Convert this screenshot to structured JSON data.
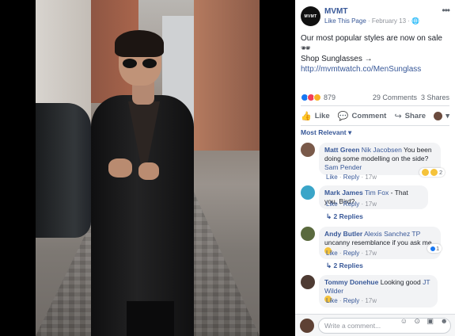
{
  "page": {
    "avatar_text": "MVMT",
    "name": "MVMT",
    "like_page": "Like This Page",
    "separator": " · ",
    "date": "February 13",
    "privacy_icon": "globe-icon",
    "more_icon": "more-dots-icon"
  },
  "post": {
    "text_line1": "Our most popular styles are now on sale 🕶",
    "text_line2": "Shop Sunglasses → ",
    "link": "http://mvmtwatch.co/MenSunglass"
  },
  "stats": {
    "reaction_count": "879",
    "comments": "29 Comments",
    "shares": "3 Shares"
  },
  "actions": {
    "like": "Like",
    "comment": "Comment",
    "share": "Share"
  },
  "sort": {
    "label": "Most Relevant ▾"
  },
  "comments": [
    {
      "author": "Matt Green",
      "tag": "Nik Jacobsen",
      "text": " You been doing some modelling on the side?",
      "tag2": "Sam Pender",
      "like": "Like",
      "reply": "Reply",
      "time": "17w",
      "reaction_count": "2"
    },
    {
      "author": "Mark James",
      "tag": "Tim Fox",
      "text": " - That you, Bird?",
      "like": "Like",
      "reply": "Reply",
      "time": "17w",
      "replies": "↳ 2 Replies"
    },
    {
      "author": "Andy Butler",
      "tag": "Alexis Sanchez TP",
      "text": " uncanny resemblance if you ask me",
      "like": "Like",
      "reply": "Reply",
      "time": "17w",
      "replies": "↳ 2 Replies",
      "reaction_count": "1"
    },
    {
      "author": "Tommy Donehue",
      "text": " Looking good ",
      "tag": "JT Wilder",
      "like": "Like",
      "reply": "Reply",
      "time": "17w"
    }
  ],
  "composer": {
    "placeholder": "Write a comment...",
    "icons": "☺ ⊙ ▣ ☻"
  }
}
